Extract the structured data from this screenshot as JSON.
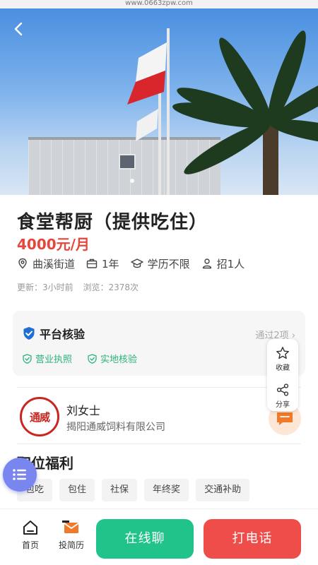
{
  "browser": {
    "url": "www.0663zpw.com"
  },
  "job": {
    "title": "食堂帮厨（提供吃住）",
    "salary": "4000元/月",
    "location": "曲溪街道",
    "experience": "1年",
    "education": "学历不限",
    "headcount": "招1人",
    "updated": "更新：3小时前",
    "views": "浏览：2378次"
  },
  "verification": {
    "title": "平台核验",
    "count": "通过2项",
    "tags": [
      "营业执照",
      "实地核验"
    ]
  },
  "floating_actions": {
    "favorite": "收藏",
    "share": "分享"
  },
  "company": {
    "contact": "刘女士",
    "name": "揭阳通威饲料有限公司",
    "logo_text": "通威"
  },
  "benefits": {
    "title": "职位福利",
    "items": [
      "包吃",
      "包住",
      "社保",
      "年终奖",
      "交通补助"
    ]
  },
  "bottom_bar": {
    "home": "首页",
    "resume": "投简历",
    "chat": "在线聊",
    "call": "打电话"
  },
  "colors": {
    "salary": "#e8453c",
    "verify_green": "#2bb37a",
    "chat_button": "#20c48a",
    "call_button": "#ef4d4a",
    "menu_fab": "#7a86f0"
  }
}
